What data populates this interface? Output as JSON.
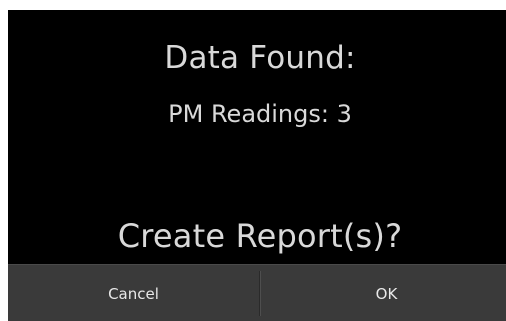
{
  "dialog": {
    "title": "Data Found:",
    "readings_text": "PM Readings: 3",
    "question": "Create Report(s)?",
    "cancel_label": "Cancel",
    "ok_label": "OK"
  },
  "colors": {
    "dialog_background": "#000000",
    "text": "#d9d9d9",
    "button_bar": "#3a3a3a"
  }
}
